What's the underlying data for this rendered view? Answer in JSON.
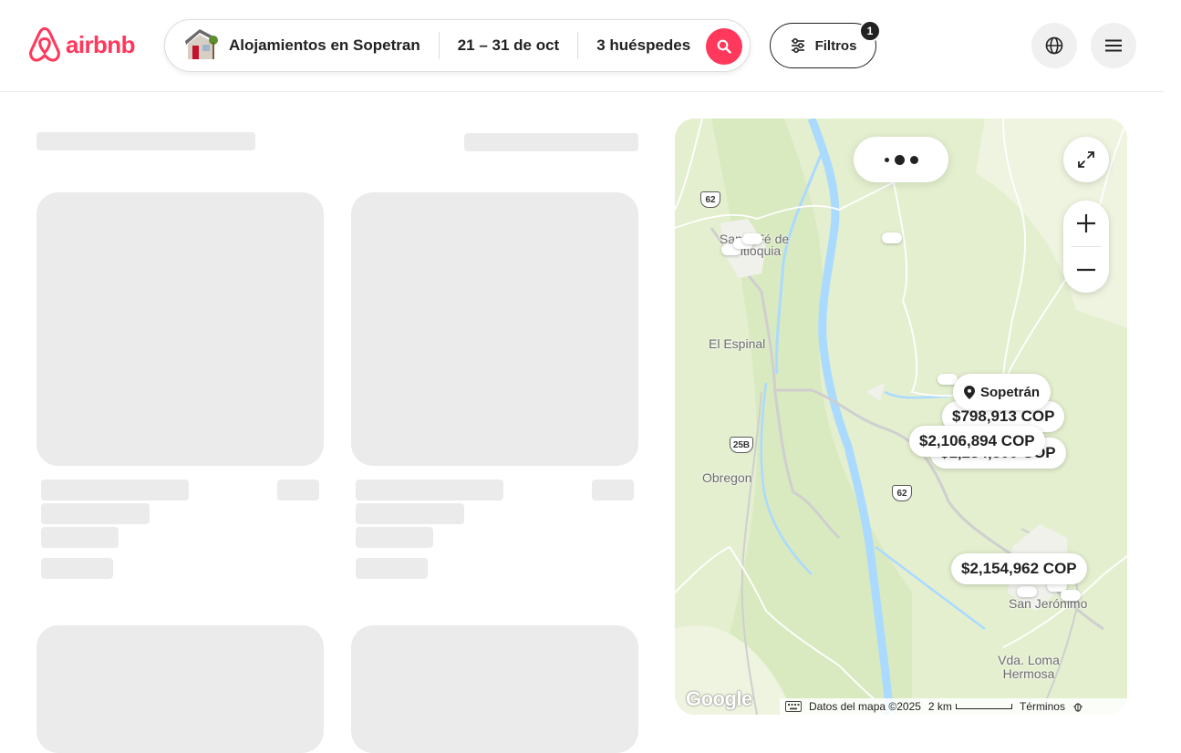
{
  "brand": {
    "name": "airbnb",
    "color": "#ff385c"
  },
  "search": {
    "location": "Alojamientos en Sopetran",
    "dates": "21 – 31 de oct",
    "guests": "3 huéspedes"
  },
  "filters": {
    "label": "Filtros",
    "badge": "1"
  },
  "map": {
    "labels": {
      "santa_fe": "Santa Fé de Antioquia",
      "el_espinal": "El Espinal",
      "obregon": "Obregon",
      "san_jeronimo": "San Jerónimo",
      "loma_hermosa": "Vda. Loma Hermosa"
    },
    "highways": {
      "h62a": "62",
      "h25b": "25B",
      "h62b": "62"
    },
    "place": "Sopetrán",
    "prices": {
      "p1": "$798,913 COP",
      "p2": "$2,106,894 COP",
      "p3": "$1,254,300 COP",
      "p4": "$2,154,962 COP"
    },
    "footer": {
      "google": "Google",
      "data": "Datos del mapa ©2025",
      "scale": "2 km",
      "terms": "Términos"
    }
  }
}
